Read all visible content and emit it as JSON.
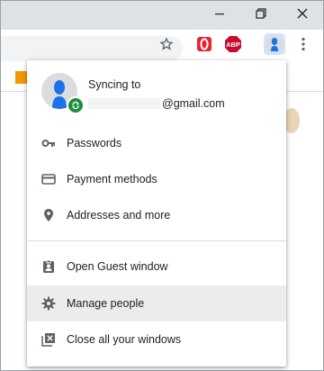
{
  "menu": {
    "sync_title": "Syncing to",
    "email_domain": "@gmail.com",
    "items": [
      {
        "label": "Passwords"
      },
      {
        "label": "Payment methods"
      },
      {
        "label": "Addresses and more"
      },
      {
        "label": "Open Guest window"
      },
      {
        "label": "Manage people"
      },
      {
        "label": "Close all your windows"
      }
    ]
  },
  "toolbar": {
    "abp_label": "ABP"
  },
  "colors": {
    "accent_blue": "#1a73e8",
    "sync_green": "#1e8e3e",
    "opera_red": "#e8222f",
    "abp_red": "#c70d2c",
    "hover_gray": "#ececec"
  },
  "icons": {
    "minimize": "minimize-icon",
    "restore": "restore-icon",
    "close": "close-icon",
    "star": "bookmark-star-icon",
    "opera": "opera-icon",
    "abp": "adblock-plus-icon",
    "profile": "profile-avatar-icon",
    "more": "more-vert-icon",
    "passwords": "key-icon",
    "payment": "credit-card-icon",
    "addresses": "location-pin-icon",
    "guest": "guest-badge-icon",
    "manage": "gear-icon",
    "close_windows": "close-box-icon"
  }
}
